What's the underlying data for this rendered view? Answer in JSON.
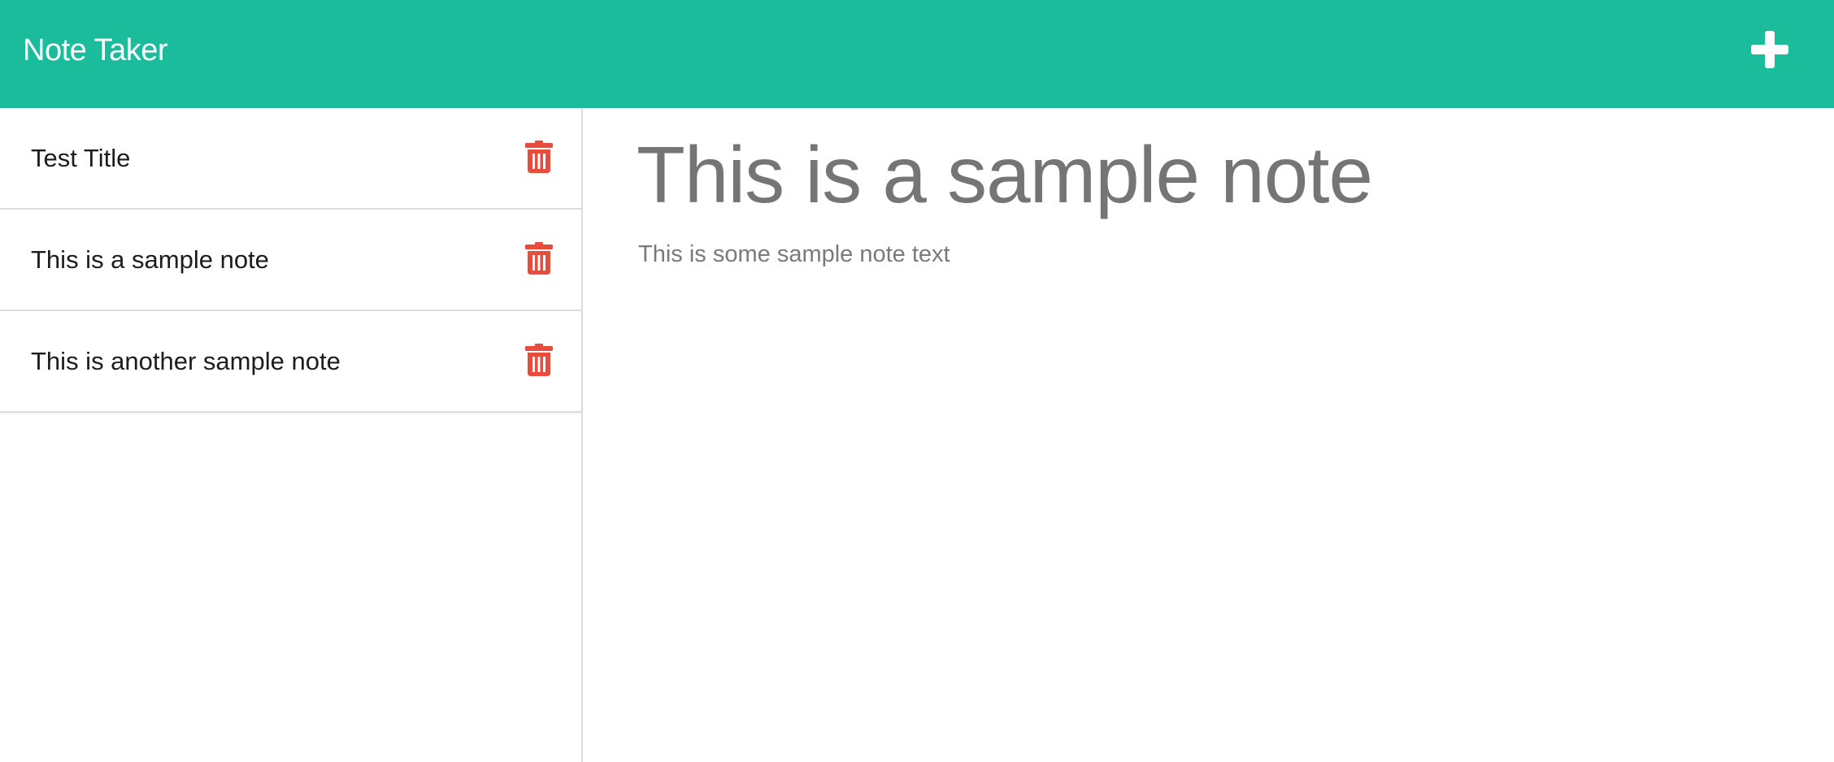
{
  "app": {
    "brand": "Note Taker"
  },
  "notes": [
    {
      "title": "Test Title"
    },
    {
      "title": "This is a sample note"
    },
    {
      "title": "This is another sample note"
    }
  ],
  "active_note": {
    "title": "This is a sample note",
    "text": "This is some sample note text"
  },
  "icons": {
    "new_note": "plus-icon",
    "delete": "trash-icon"
  },
  "colors": {
    "navbar": "#1abc9c",
    "delete_icon": "#e74c3c",
    "note_heading": "#757575"
  }
}
